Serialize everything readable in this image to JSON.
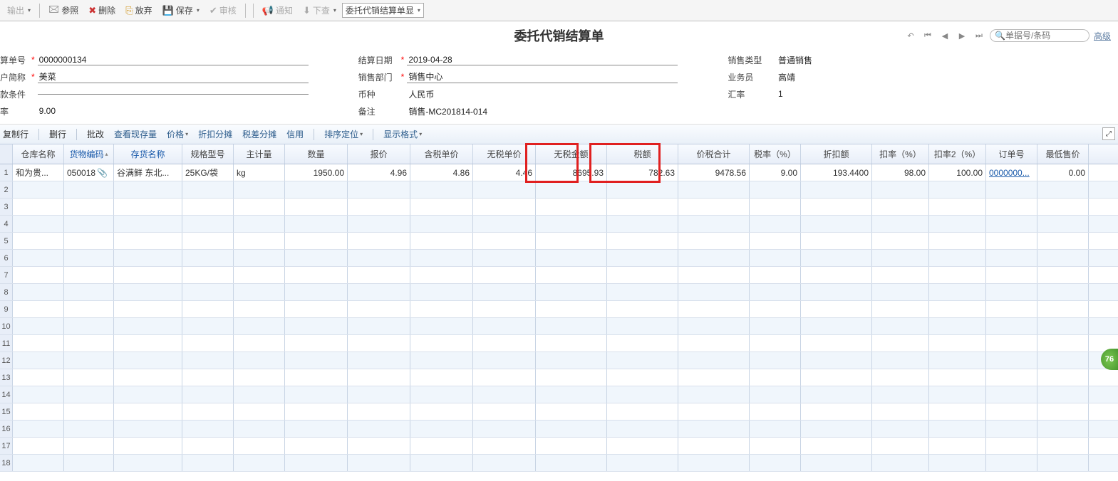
{
  "toolbar": {
    "output": "输出",
    "ref": "参照",
    "delete": "删除",
    "discard": "放弃",
    "save": "保存",
    "audit": "审核",
    "notify": "通知",
    "next": "下查",
    "display": "委托代销结算单显"
  },
  "title": "委托代销结算单",
  "nav": {
    "search_placeholder": "单据号/条码",
    "advanced": "高级"
  },
  "form": {
    "doc_no_label": "算单号",
    "doc_no": "0000000134",
    "cust_label": "户简称",
    "cust": "美菜",
    "paycond_label": "款条件",
    "paycond": "",
    "rate_label": "率",
    "rate": "9.00",
    "settle_date_label": "结算日期",
    "settle_date": "2019-04-28",
    "dept_label": "销售部门",
    "dept": "销售中心",
    "currency_label": "币种",
    "currency": "人民币",
    "remark_label": "备注",
    "remark": "销售-MC201814-014",
    "sale_type_label": "销售类型",
    "sale_type": "普通销售",
    "clerk_label": "业务员",
    "clerk": "高靖",
    "exrate_label": "汇率",
    "exrate": "1"
  },
  "actions": {
    "copyrow": "复制行",
    "delrow": "删行",
    "batch": "批改",
    "stock": "查看现存量",
    "price": "价格",
    "disc_split": "折扣分摊",
    "taxdiff": "税差分摊",
    "credit": "信用",
    "sort": "排序定位",
    "display": "显示格式"
  },
  "columns": {
    "warehouse": "仓库名称",
    "code": "货物编码",
    "name": "存货名称",
    "spec": "规格型号",
    "unit": "主计量",
    "qty": "数量",
    "price": "报价",
    "taxprice": "含税单价",
    "notaxprice": "无税单价",
    "notaxamt": "无税金额",
    "taxamt": "税额",
    "total": "价税合计",
    "taxrate": "税率（%）",
    "discamt": "折扣额",
    "discrate": "扣率（%）",
    "discrate2": "扣率2（%）",
    "order": "订单号",
    "minprice": "最低售价"
  },
  "rows": [
    {
      "warehouse": "和为贵...",
      "code": "050018",
      "name": "谷满鲜 东北...",
      "spec": "25KG/袋",
      "unit": "kg",
      "qty": "1950.00",
      "price": "4.96",
      "taxprice": "4.86",
      "notaxprice": "4.46",
      "notaxamt": "8695.93",
      "taxamt": "782.63",
      "total": "9478.56",
      "taxrate": "9.00",
      "discamt": "193.4400",
      "discrate": "98.00",
      "discrate2": "100.00",
      "order": "0000000...",
      "minprice": "0.00"
    }
  ],
  "badge": "76"
}
